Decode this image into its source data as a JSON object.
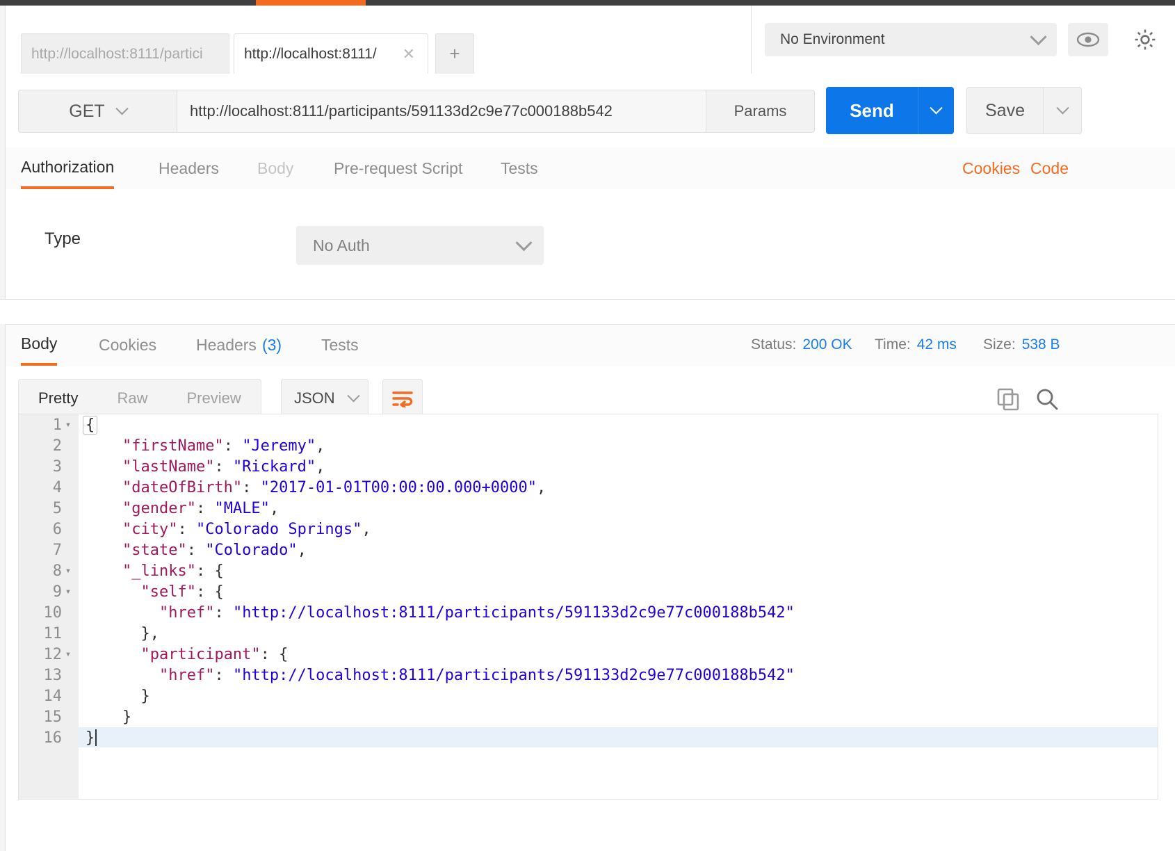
{
  "window": {
    "accent_color": "#f26b21",
    "chrome_color": "#3f3f3f"
  },
  "tabs": {
    "inactive_label": "http://localhost:8111/partici",
    "active_label": "http://localhost:8111/",
    "close_glyph": "✕",
    "new_tab_glyph": "+"
  },
  "environment": {
    "selected": "No Environment",
    "eye_icon": "eye-icon",
    "gear_icon": "gear-icon"
  },
  "request": {
    "method": "GET",
    "url": "http://localhost:8111/participants/591133d2c9e77c000188b542",
    "params_label": "Params",
    "send_label": "Send",
    "save_label": "Save"
  },
  "request_tabs": {
    "items": [
      {
        "label": "Authorization",
        "state": "active"
      },
      {
        "label": "Headers",
        "state": "normal"
      },
      {
        "label": "Body",
        "state": "dim"
      },
      {
        "label": "Pre-request Script",
        "state": "normal"
      },
      {
        "label": "Tests",
        "state": "normal"
      }
    ],
    "cookies_link": "Cookies",
    "code_link": "Code"
  },
  "auth": {
    "type_label": "Type",
    "type_value": "No Auth"
  },
  "response_tabs": {
    "items": [
      {
        "label": "Body",
        "state": "active",
        "count": ""
      },
      {
        "label": "Cookies",
        "state": "normal",
        "count": ""
      },
      {
        "label": "Headers",
        "state": "normal",
        "count": "(3)"
      },
      {
        "label": "Tests",
        "state": "normal",
        "count": ""
      }
    ],
    "meta": [
      {
        "label": "Status:",
        "value": "200 OK"
      },
      {
        "label": "Time:",
        "value": "42 ms"
      },
      {
        "label": "Size:",
        "value": "538 B"
      }
    ]
  },
  "response_toolbar": {
    "formats": [
      {
        "label": "Pretty",
        "state": "active"
      },
      {
        "label": "Raw",
        "state": "normal"
      },
      {
        "label": "Preview",
        "state": "normal"
      }
    ],
    "language": "JSON",
    "wrap_icon": "word-wrap-icon",
    "copy_icon": "copy-icon",
    "search_icon": "search-icon"
  },
  "code": {
    "lines": [
      {
        "n": "1",
        "fold": "▾",
        "highlight": false,
        "tokens": [
          {
            "t": "brace",
            "v": "{"
          }
        ]
      },
      {
        "n": "2",
        "fold": "",
        "highlight": false,
        "tokens": [
          {
            "t": "pun",
            "v": "    "
          },
          {
            "t": "key",
            "v": "\"firstName\""
          },
          {
            "t": "pun",
            "v": ": "
          },
          {
            "t": "str",
            "v": "\"Jeremy\""
          },
          {
            "t": "pun",
            "v": ","
          }
        ]
      },
      {
        "n": "3",
        "fold": "",
        "highlight": false,
        "tokens": [
          {
            "t": "pun",
            "v": "    "
          },
          {
            "t": "key",
            "v": "\"lastName\""
          },
          {
            "t": "pun",
            "v": ": "
          },
          {
            "t": "str",
            "v": "\"Rickard\""
          },
          {
            "t": "pun",
            "v": ","
          }
        ]
      },
      {
        "n": "4",
        "fold": "",
        "highlight": false,
        "tokens": [
          {
            "t": "pun",
            "v": "    "
          },
          {
            "t": "key",
            "v": "\"dateOfBirth\""
          },
          {
            "t": "pun",
            "v": ": "
          },
          {
            "t": "str",
            "v": "\"2017-01-01T00:00:00.000+0000\""
          },
          {
            "t": "pun",
            "v": ","
          }
        ]
      },
      {
        "n": "5",
        "fold": "",
        "highlight": false,
        "tokens": [
          {
            "t": "pun",
            "v": "    "
          },
          {
            "t": "key",
            "v": "\"gender\""
          },
          {
            "t": "pun",
            "v": ": "
          },
          {
            "t": "str",
            "v": "\"MALE\""
          },
          {
            "t": "pun",
            "v": ","
          }
        ]
      },
      {
        "n": "6",
        "fold": "",
        "highlight": false,
        "tokens": [
          {
            "t": "pun",
            "v": "    "
          },
          {
            "t": "key",
            "v": "\"city\""
          },
          {
            "t": "pun",
            "v": ": "
          },
          {
            "t": "str",
            "v": "\"Colorado Springs\""
          },
          {
            "t": "pun",
            "v": ","
          }
        ]
      },
      {
        "n": "7",
        "fold": "",
        "highlight": false,
        "tokens": [
          {
            "t": "pun",
            "v": "    "
          },
          {
            "t": "key",
            "v": "\"state\""
          },
          {
            "t": "pun",
            "v": ": "
          },
          {
            "t": "str",
            "v": "\"Colorado\""
          },
          {
            "t": "pun",
            "v": ","
          }
        ]
      },
      {
        "n": "8",
        "fold": "▾",
        "highlight": false,
        "tokens": [
          {
            "t": "pun",
            "v": "    "
          },
          {
            "t": "key",
            "v": "\"_links\""
          },
          {
            "t": "pun",
            "v": ": {"
          }
        ]
      },
      {
        "n": "9",
        "fold": "▾",
        "highlight": false,
        "tokens": [
          {
            "t": "pun",
            "v": "      "
          },
          {
            "t": "key",
            "v": "\"self\""
          },
          {
            "t": "pun",
            "v": ": {"
          }
        ]
      },
      {
        "n": "10",
        "fold": "",
        "highlight": false,
        "tokens": [
          {
            "t": "pun",
            "v": "        "
          },
          {
            "t": "key",
            "v": "\"href\""
          },
          {
            "t": "pun",
            "v": ": "
          },
          {
            "t": "str",
            "v": "\"http://localhost:8111/participants/591133d2c9e77c000188b542\""
          }
        ]
      },
      {
        "n": "11",
        "fold": "",
        "highlight": false,
        "tokens": [
          {
            "t": "pun",
            "v": "      },"
          }
        ]
      },
      {
        "n": "12",
        "fold": "▾",
        "highlight": false,
        "tokens": [
          {
            "t": "pun",
            "v": "      "
          },
          {
            "t": "key",
            "v": "\"participant\""
          },
          {
            "t": "pun",
            "v": ": {"
          }
        ]
      },
      {
        "n": "13",
        "fold": "",
        "highlight": false,
        "tokens": [
          {
            "t": "pun",
            "v": "        "
          },
          {
            "t": "key",
            "v": "\"href\""
          },
          {
            "t": "pun",
            "v": ": "
          },
          {
            "t": "str",
            "v": "\"http://localhost:8111/participants/591133d2c9e77c000188b542\""
          }
        ]
      },
      {
        "n": "14",
        "fold": "",
        "highlight": false,
        "tokens": [
          {
            "t": "pun",
            "v": "      }"
          }
        ]
      },
      {
        "n": "15",
        "fold": "",
        "highlight": false,
        "tokens": [
          {
            "t": "pun",
            "v": "    }"
          }
        ]
      },
      {
        "n": "16",
        "fold": "",
        "highlight": true,
        "tokens": [
          {
            "t": "pun",
            "v": "}"
          },
          {
            "t": "caret",
            "v": ""
          }
        ]
      }
    ]
  }
}
